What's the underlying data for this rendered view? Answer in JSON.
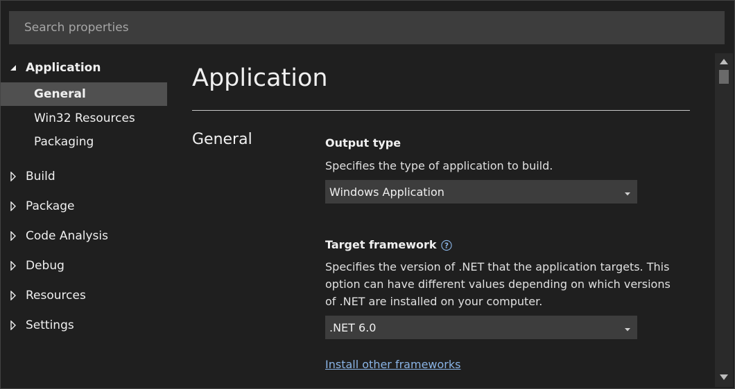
{
  "search": {
    "placeholder": "Search properties",
    "value": ""
  },
  "sidebar": {
    "group_open": {
      "label": "Application",
      "icon": "triangle-expanded-icon",
      "children": [
        {
          "label": "General",
          "selected": true
        },
        {
          "label": "Win32 Resources",
          "selected": false
        },
        {
          "label": "Packaging",
          "selected": false
        }
      ]
    },
    "groups": [
      {
        "label": "Build",
        "icon": "triangle-collapsed-icon"
      },
      {
        "label": "Package",
        "icon": "triangle-collapsed-icon"
      },
      {
        "label": "Code Analysis",
        "icon": "triangle-collapsed-icon"
      },
      {
        "label": "Debug",
        "icon": "triangle-collapsed-icon"
      },
      {
        "label": "Resources",
        "icon": "triangle-collapsed-icon"
      },
      {
        "label": "Settings",
        "icon": "triangle-collapsed-icon"
      }
    ]
  },
  "main": {
    "title": "Application",
    "section": "General",
    "output_type": {
      "label": "Output type",
      "description": "Specifies the type of application to build.",
      "selected": "Windows Application"
    },
    "target_framework": {
      "label": "Target framework",
      "help_icon": "help-circle-icon",
      "description": "Specifies the version of .NET that the application targets. This option can have different values depending on which versions of .NET are installed on your computer.",
      "selected": ".NET 6.0"
    },
    "install_link": "Install other frameworks"
  },
  "colors": {
    "background": "#1f1f1f",
    "search_bg": "#3d3d3d",
    "selected_bg": "#505050",
    "dropdown_bg": "#3d3d3d",
    "link": "#8ab4e6",
    "text": "#f0f0f0"
  }
}
